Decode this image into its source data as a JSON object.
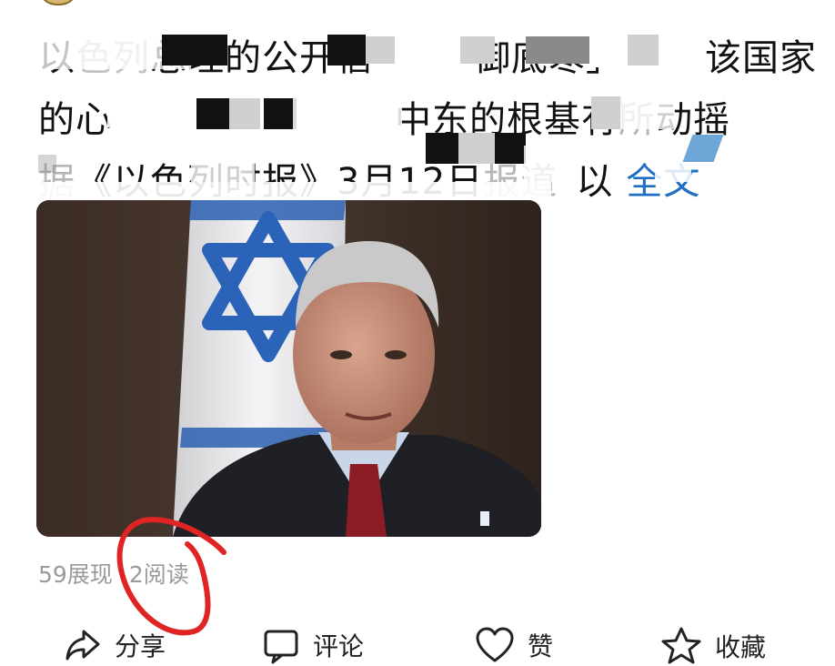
{
  "post": {
    "text_lines": [
      [
        "以",
        "色列",
        "总理的公开信",
        "",
        "御底寒」",
        "",
        "该国家"
      ],
      [
        "的",
        "心",
        "",
        "",
        "",
        "中东的根基有",
        "所",
        "动摇"
      ],
      [
        "据",
        "《以色列",
        "时报》3月12日",
        "报道",
        "以",
        "全文"
      ]
    ],
    "link_label": "全文"
  },
  "image": {
    "description_icon": "news-photo-icon"
  },
  "stats": {
    "impressions": "59展现",
    "reads": "2阅读"
  },
  "actions": {
    "share": "分享",
    "comment": "评论",
    "like": "赞",
    "favorite": "收藏"
  },
  "colors": {
    "link": "#1e6fc4",
    "annotation": "#e02424",
    "stats": "#9a9a9a"
  }
}
